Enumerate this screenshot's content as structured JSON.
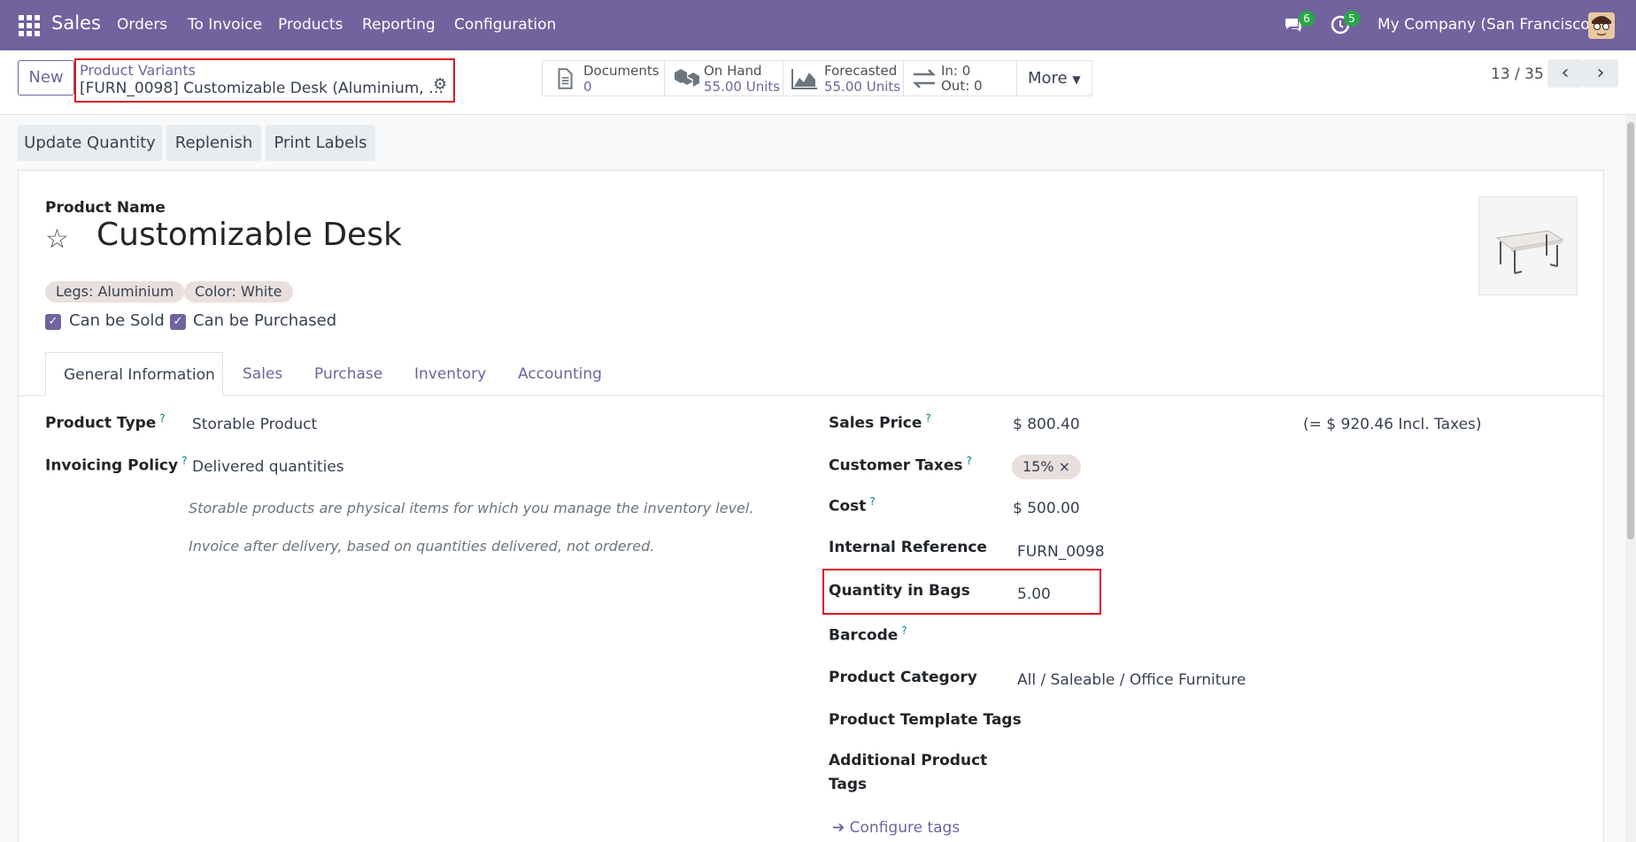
{
  "navbar": {
    "app_name": "Sales",
    "menu": [
      "Orders",
      "To Invoice",
      "Products",
      "Reporting",
      "Configuration"
    ],
    "messages_count": "6",
    "activities_count": "5",
    "company": "My Company (San Francisco)"
  },
  "control_panel": {
    "new_label": "New",
    "breadcrumb_parent": "Product Variants",
    "breadcrumb_current": "[FURN_0098] Customizable Desk (Aluminium, …",
    "stats": {
      "documents_label": "Documents",
      "documents_value": "0",
      "on_hand_label": "On Hand",
      "on_hand_value": "55.00 Units",
      "forecasted_label": "Forecasted",
      "forecasted_value": "55.00 Units",
      "in_label": "In: 0",
      "out_label": "Out: 0",
      "more_label": "More"
    },
    "pager": "13 / 35"
  },
  "actions": {
    "update_quantity": "Update Quantity",
    "replenish": "Replenish",
    "print_labels": "Print Labels"
  },
  "product": {
    "name_label": "Product Name",
    "name": "Customizable Desk",
    "tags": [
      "Legs: Aluminium",
      "Color: White"
    ],
    "can_be_sold": "Can be Sold",
    "can_be_purchased": "Can be Purchased"
  },
  "tabs": [
    "General Information",
    "Sales",
    "Purchase",
    "Inventory",
    "Accounting"
  ],
  "general": {
    "product_type_label": "Product Type",
    "product_type": "Storable Product",
    "invoicing_policy_label": "Invoicing Policy",
    "invoicing_policy": "Delivered quantities",
    "hint_storable": "Storable products are physical items for which you manage the inventory level.",
    "hint_invoice": "Invoice after delivery, based on quantities delivered, not ordered.",
    "sales_price_label": "Sales Price",
    "sales_price": "$ 800.40",
    "incl_taxes": "(= $ 920.46 Incl. Taxes)",
    "customer_taxes_label": "Customer Taxes",
    "customer_tax": "15% ×",
    "cost_label": "Cost",
    "cost": "$ 500.00",
    "internal_ref_label": "Internal Reference",
    "internal_ref": "FURN_0098",
    "qty_bags_label": "Quantity in Bags",
    "qty_bags": "5.00",
    "barcode_label": "Barcode",
    "category_label": "Product Category",
    "category": "All / Saleable / Office Furniture",
    "template_tags_label": "Product Template Tags",
    "additional_tags_label_1": "Additional Product",
    "additional_tags_label_2": "Tags",
    "configure_tags": "Configure tags",
    "help_mark": "?"
  }
}
